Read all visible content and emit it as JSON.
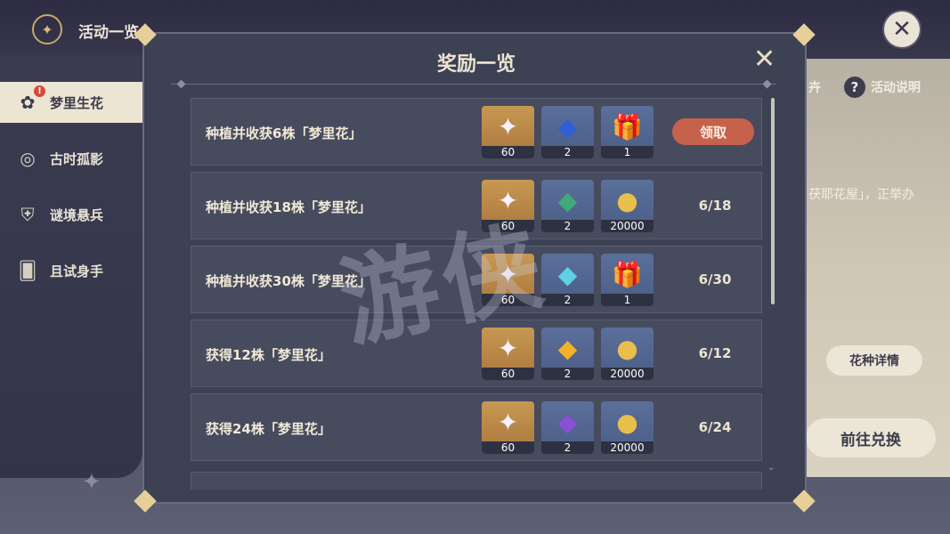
{
  "top": {
    "title": "活动一览"
  },
  "sidebar": {
    "items": [
      {
        "label": "梦里生花",
        "icon": "flower-icon",
        "badge": "!"
      },
      {
        "label": "古时孤影",
        "icon": "shield-icon"
      },
      {
        "label": "谜境悬兵",
        "icon": "armor-icon"
      },
      {
        "label": "且试身手",
        "icon": "cards-icon"
      }
    ]
  },
  "background": {
    "fragment1": "卉",
    "howto": "活动说明",
    "fragment2": "茯耶花屋」，正举办",
    "flower_detail": "花种详情",
    "exchange": "前往兑换"
  },
  "modal": {
    "title": "奖励一览",
    "claim_label": "领取",
    "rows": [
      {
        "label": "种植并收获6株「梦里花」",
        "rewards": [
          {
            "icon": "primogem-icon",
            "count": "60"
          },
          {
            "icon": "blue-crystal-icon",
            "count": "2"
          },
          {
            "icon": "gift-box-icon",
            "count": "1"
          }
        ],
        "status": "claim"
      },
      {
        "label": "种植并收获18株「梦里花」",
        "rewards": [
          {
            "icon": "primogem-icon",
            "count": "60"
          },
          {
            "icon": "green-crystal-icon",
            "count": "2"
          },
          {
            "icon": "mora-coin-icon",
            "count": "20000"
          }
        ],
        "progress": "6/18"
      },
      {
        "label": "种植并收获30株「梦里花」",
        "rewards": [
          {
            "icon": "primogem-icon",
            "count": "60"
          },
          {
            "icon": "cyan-crystal-icon",
            "count": "2"
          },
          {
            "icon": "gift-box-icon",
            "count": "1"
          }
        ],
        "progress": "6/30"
      },
      {
        "label": "获得12株「梦里花」",
        "rewards": [
          {
            "icon": "primogem-icon",
            "count": "60"
          },
          {
            "icon": "yellow-crystal-icon",
            "count": "2"
          },
          {
            "icon": "mora-coin-icon",
            "count": "20000"
          }
        ],
        "progress": "6/12"
      },
      {
        "label": "获得24株「梦里花」",
        "rewards": [
          {
            "icon": "primogem-icon",
            "count": "60"
          },
          {
            "icon": "purple-crystal-icon",
            "count": "2"
          },
          {
            "icon": "mora-coin-icon",
            "count": "20000"
          }
        ],
        "progress": "6/24"
      }
    ]
  },
  "colors": {
    "claim": "#c6624c",
    "gold_tile": "#c79852",
    "blue_tile": "#5a6f9a"
  }
}
